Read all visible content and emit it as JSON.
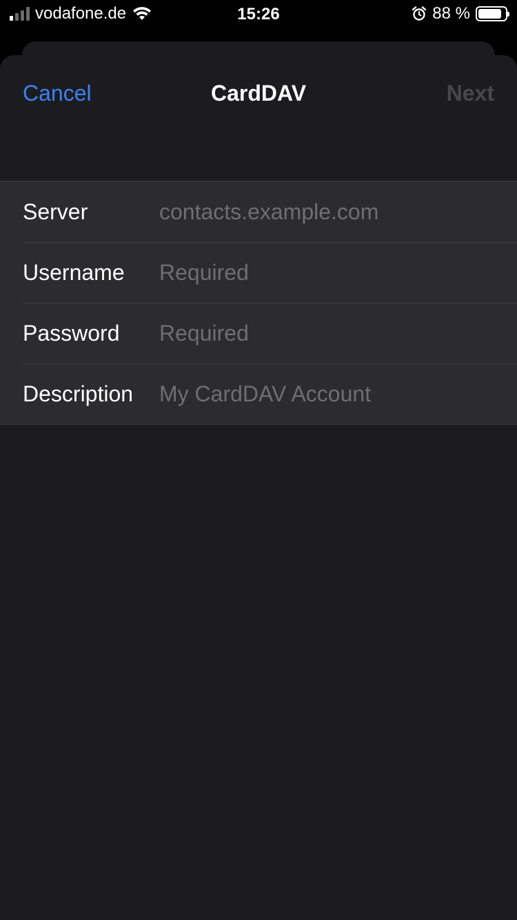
{
  "status_bar": {
    "carrier": "vodafone.de",
    "time": "15:26",
    "battery_percent": "88 %",
    "battery_level": 0.88,
    "signal_bars": 4,
    "signal_bars_filled": 1
  },
  "nav": {
    "cancel_label": "Cancel",
    "title": "CardDAV",
    "next_label": "Next"
  },
  "form": {
    "server": {
      "label": "Server",
      "value": "",
      "placeholder": "contacts.example.com"
    },
    "username": {
      "label": "Username",
      "value": "",
      "placeholder": "Required"
    },
    "password": {
      "label": "Password",
      "value": "",
      "placeholder": "Required"
    },
    "description": {
      "label": "Description",
      "value": "",
      "placeholder": "My CardDAV Account"
    }
  },
  "colors": {
    "accent": "#3a82f7",
    "disabled": "#48484a",
    "sheet_bg": "#1c1c1e",
    "row_bg": "#2c2c2e"
  }
}
